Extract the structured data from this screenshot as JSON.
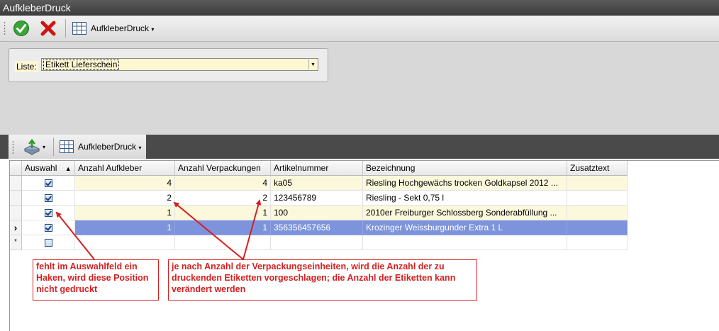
{
  "window": {
    "title": "AufkleberDruck"
  },
  "toolbar": {
    "confirm": "confirm-icon",
    "cancel": "cancel-icon",
    "layout_icon": "grid-icon",
    "menu_label": "AufkleberDruck"
  },
  "filter": {
    "label": "Liste:",
    "value": "Etikett Lieferschein"
  },
  "grid_toolbar": {
    "export_icon": "export-icon",
    "layout_icon": "grid-icon",
    "menu_label": "AufkleberDruck"
  },
  "grid": {
    "columns": [
      "Auswahl",
      "Anzahl Aufkleber",
      "Anzahl Verpackungen",
      "Artikelnummer",
      "Bezeichnung",
      "Zusatztext"
    ],
    "sort_indicator": "▲",
    "rows": [
      {
        "selected": true,
        "aufkleber": "4",
        "verpackungen": "4",
        "artikelnummer": "ka05",
        "bezeichnung": "Riesling Hochgewächs trocken Goldkapsel 2012 ...",
        "zusatztext": ""
      },
      {
        "selected": true,
        "aufkleber": "2",
        "verpackungen": "2",
        "artikelnummer": "123456789",
        "bezeichnung": "Riesling - Sekt 0,75 l",
        "zusatztext": ""
      },
      {
        "selected": true,
        "aufkleber": "1",
        "verpackungen": "1",
        "artikelnummer": "100",
        "bezeichnung": "2010er Freiburger Schlossberg Sonderabfüllung ...",
        "zusatztext": ""
      },
      {
        "selected": true,
        "aufkleber": "1",
        "verpackungen": "1",
        "artikelnummer": "356356457656",
        "bezeichnung": "Krozinger Weissburgunder Extra 1 L",
        "zusatztext": ""
      }
    ],
    "current_row_marker": "›",
    "new_row_marker": "*"
  },
  "annotations": {
    "left": "fehlt im Auswahlfeld ein Haken, wird diese Position nicht gedruckt",
    "right": "je nach Anzahl der Verpackungseinheiten, wird die Anzahl der zu druckenden Etiketten vorgeschlagen; die Anzahl der Etiketten kann verändert werden"
  },
  "colors": {
    "row_highlight": "#fbf8dc",
    "row_selected": "#7d94dc",
    "annotation": "#d42020"
  }
}
